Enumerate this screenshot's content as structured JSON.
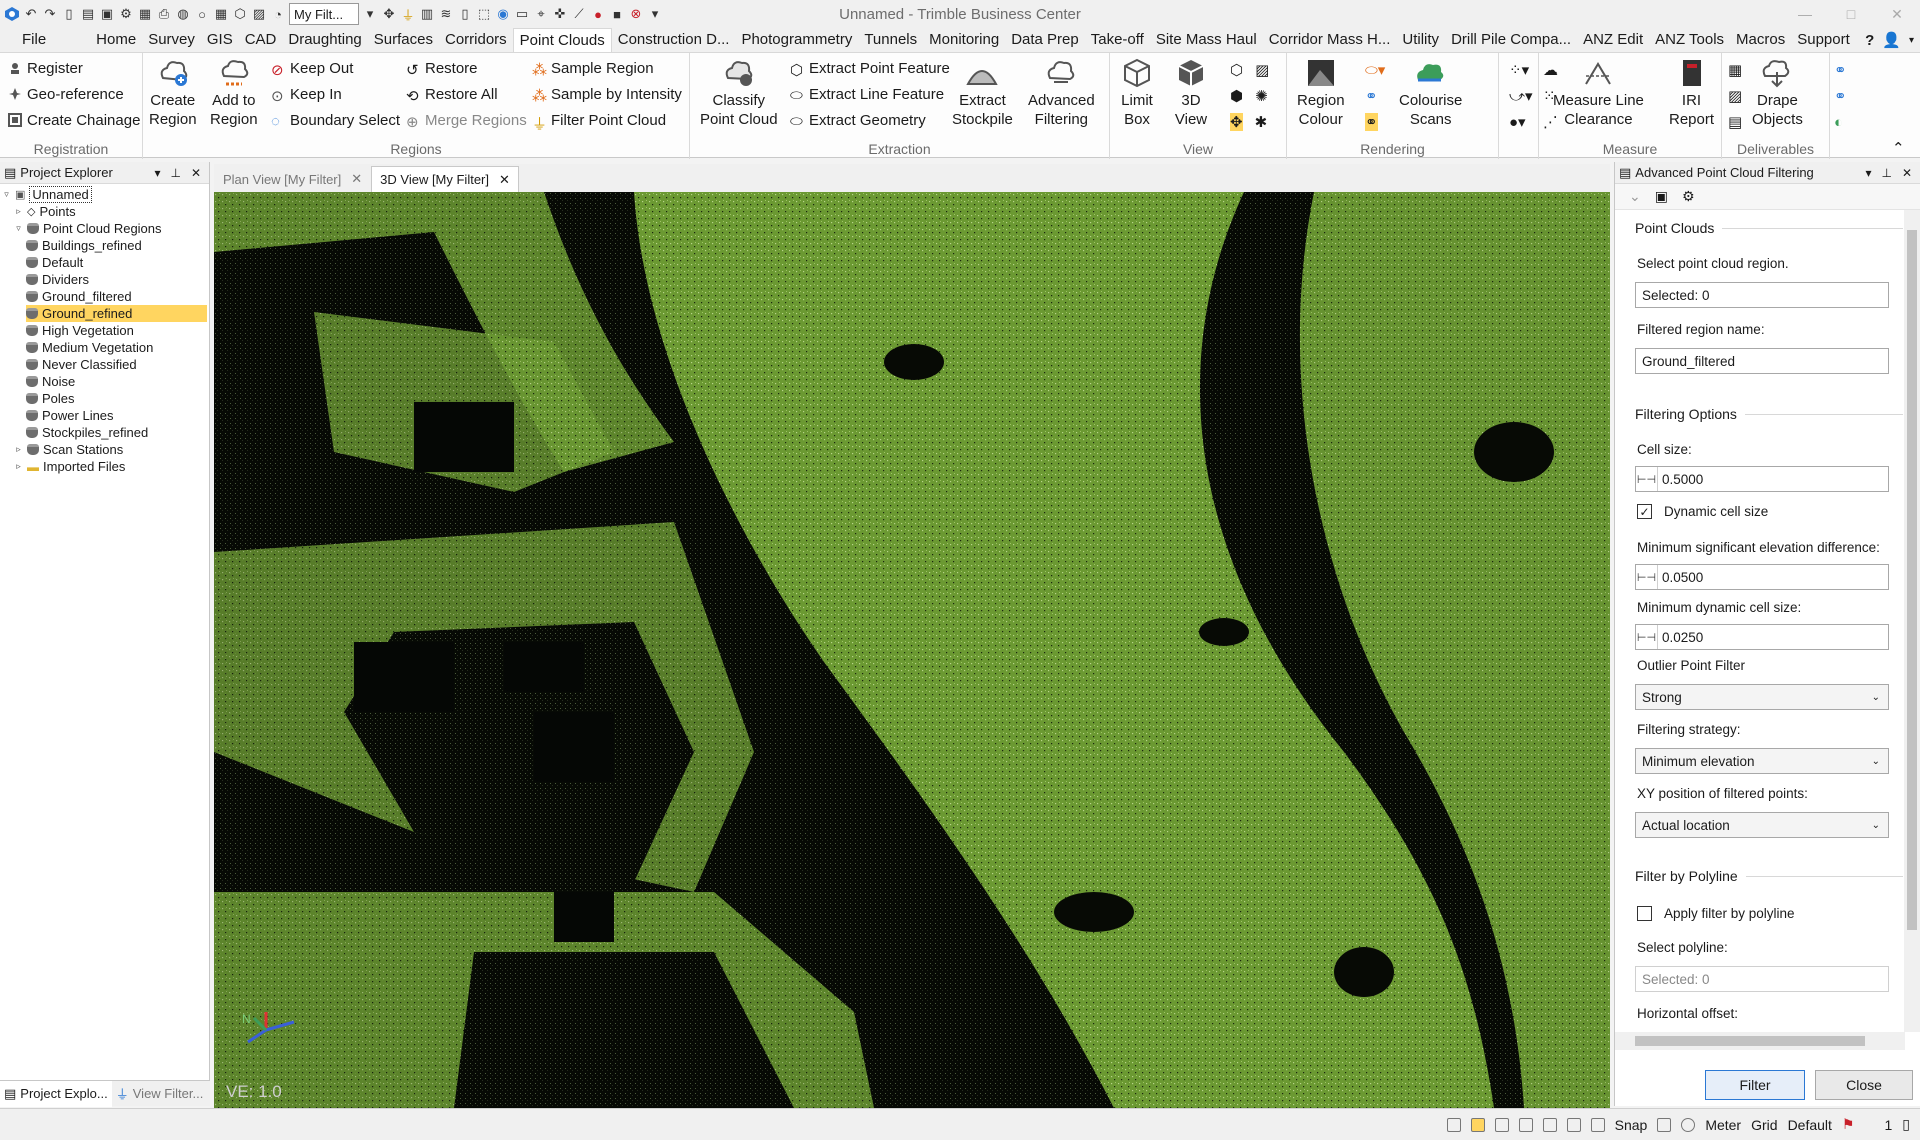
{
  "window": {
    "title": "Unnamed - Trimble Business Center",
    "filter_select": "My Filt..."
  },
  "menu": {
    "items": [
      "File",
      "Home",
      "Survey",
      "GIS",
      "CAD",
      "Draughting",
      "Surfaces",
      "Corridors",
      "Point Clouds",
      "Construction D...",
      "Photogrammetry",
      "Tunnels",
      "Monitoring",
      "Data Prep",
      "Take-off",
      "Site Mass Haul",
      "Corridor Mass H...",
      "Utility",
      "Drill Pile Compa...",
      "ANZ Edit",
      "ANZ Tools",
      "Macros",
      "Support"
    ],
    "active_index": 8,
    "help": "?"
  },
  "ribbon": {
    "registration": {
      "label": "Registration",
      "items": [
        "Register",
        "Geo-reference",
        "Create Chainage"
      ]
    },
    "regions": {
      "label": "Regions",
      "big": [
        {
          "l1": "Create",
          "l2": "Region"
        },
        {
          "l1": "Add to",
          "l2": "Region"
        }
      ],
      "col1": [
        "Keep Out",
        "Keep In",
        "Boundary Select"
      ],
      "col2": [
        "Restore",
        "Restore All",
        "Merge Regions"
      ],
      "col3": [
        "Sample Region",
        "Sample by Intensity",
        "Filter Point Cloud"
      ]
    },
    "extraction": {
      "label": "Extraction",
      "big1": {
        "l1": "Classify",
        "l2": "Point Cloud"
      },
      "items": [
        "Extract Point Feature",
        "Extract Line Feature",
        "Extract Geometry"
      ],
      "big2": {
        "l1": "Extract",
        "l2": "Stockpile"
      },
      "big3": {
        "l1": "Advanced",
        "l2": "Filtering"
      }
    },
    "view": {
      "label": "View",
      "big": [
        {
          "l1": "Limit",
          "l2": "Box"
        },
        {
          "l1": "3D",
          "l2": "View"
        }
      ]
    },
    "rendering": {
      "label": "Rendering",
      "big": [
        {
          "l1": "Region",
          "l2": "Colour"
        },
        {
          "l1": "Colourise",
          "l2": "Scans"
        }
      ]
    },
    "measure": {
      "label": "Measure",
      "big": [
        {
          "l1": "Measure Line",
          "l2": "Clearance"
        },
        {
          "l1": "IRI",
          "l2": "Report"
        }
      ]
    },
    "deliverables": {
      "label": "Deliverables",
      "big": [
        {
          "l1": "Drape",
          "l2": "Objects"
        }
      ]
    }
  },
  "project_explorer": {
    "title": "Project Explorer",
    "root": "Unnamed",
    "points": "Points",
    "regions_header": "Point Cloud Regions",
    "regions": [
      "Buildings_refined",
      "Default",
      "Dividers",
      "Ground_filtered",
      "Ground_refined",
      "High Vegetation",
      "Medium Vegetation",
      "Never Classified",
      "Noise",
      "Poles",
      "Power Lines",
      "Stockpiles_refined"
    ],
    "selected_region": "Ground_refined",
    "scan_stations": "Scan Stations",
    "imported_files": "Imported Files",
    "bottom_tabs": [
      "Project Explo...",
      "View Filter..."
    ]
  },
  "views": {
    "tabs": [
      "Plan View [My Filter]",
      "3D View [My Filter]"
    ],
    "active_tab": 1,
    "ve_label": "VE: 1.0",
    "axis": {
      "n": "N"
    }
  },
  "apf": {
    "title": "Advanced Point Cloud Filtering",
    "point_clouds": {
      "title": "Point Clouds",
      "select_label": "Select point cloud region.",
      "selected_value": "Selected: 0",
      "name_label": "Filtered region name:",
      "name_value": "Ground_filtered"
    },
    "filtering": {
      "title": "Filtering Options",
      "cell_size_label": "Cell size:",
      "cell_size": "0.5000",
      "dynamic_label": "Dynamic cell size",
      "dynamic_checked": true,
      "min_elev_label": "Minimum significant elevation difference:",
      "min_elev": "0.0500",
      "min_dyn_label": "Minimum dynamic cell size:",
      "min_dyn": "0.0250",
      "outlier_label": "Outlier Point Filter",
      "outlier": "Strong",
      "strategy_label": "Filtering strategy:",
      "strategy": "Minimum elevation",
      "xy_label": "XY position of filtered points:",
      "xy": "Actual location"
    },
    "polyline": {
      "title": "Filter by Polyline",
      "apply_label": "Apply filter by polyline",
      "apply_checked": false,
      "select_label": "Select polyline:",
      "selected_value": "Selected: 0",
      "offset_label": "Horizontal offset:"
    },
    "filter_button": "Filter",
    "close_button": "Close"
  },
  "statusbar": {
    "snap": "Snap",
    "units": "Meter",
    "grid": "Grid",
    "default": "Default",
    "page": "1"
  },
  "colors": {
    "accent": "#2b78d4",
    "selection": "#ffd560",
    "cloud": "#7aa83a"
  }
}
